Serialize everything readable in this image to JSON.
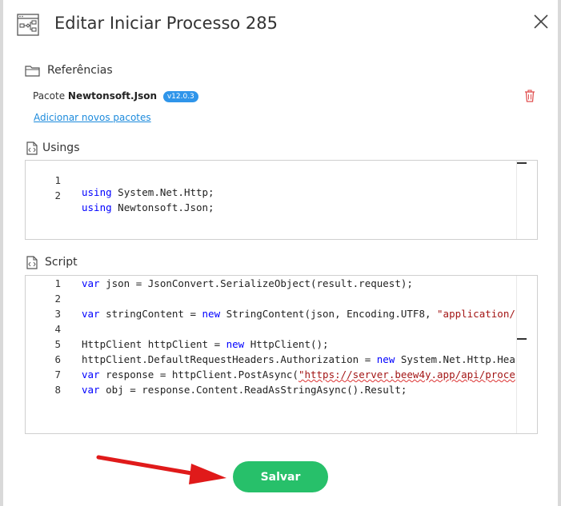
{
  "dialog": {
    "title": "Editar Iniciar Processo 285",
    "save_label": "Salvar"
  },
  "references": {
    "label": "Referências",
    "package_prefix": "Pacote",
    "package_name": "Newtonsoft.Json",
    "package_version": "v12.0.3",
    "add_link": "Adicionar novos pacotes"
  },
  "usings": {
    "label": "Usings",
    "lines": [
      {
        "n": "1",
        "tokens": [
          {
            "t": "kw",
            "v": "using"
          },
          {
            "t": "",
            "v": " System.Net.Http;"
          }
        ]
      },
      {
        "n": "2",
        "tokens": [
          {
            "t": "kw",
            "v": "using"
          },
          {
            "t": "",
            "v": " Newtonsoft.Json;"
          }
        ]
      }
    ]
  },
  "script": {
    "label": "Script",
    "lines": [
      {
        "n": "1",
        "tokens": [
          {
            "t": "kw",
            "v": "var"
          },
          {
            "t": "",
            "v": " json = JsonConvert.SerializeObject(result.request);"
          }
        ]
      },
      {
        "n": "2",
        "tokens": []
      },
      {
        "n": "3",
        "tokens": [
          {
            "t": "kw",
            "v": "var"
          },
          {
            "t": "",
            "v": " stringContent = "
          },
          {
            "t": "kw",
            "v": "new"
          },
          {
            "t": "",
            "v": " StringContent(json, Encoding.UTF8, "
          },
          {
            "t": "str",
            "v": "\"application/"
          }
        ]
      },
      {
        "n": "4",
        "tokens": []
      },
      {
        "n": "5",
        "tokens": [
          {
            "t": "",
            "v": "HttpClient httpClient = "
          },
          {
            "t": "kw",
            "v": "new"
          },
          {
            "t": "",
            "v": " HttpClient();"
          }
        ]
      },
      {
        "n": "6",
        "tokens": [
          {
            "t": "",
            "v": "httpClient.DefaultRequestHeaders.Authorization = "
          },
          {
            "t": "kw",
            "v": "new"
          },
          {
            "t": "",
            "v": " System.Net.Http.Hea"
          }
        ]
      },
      {
        "n": "7",
        "tokens": [
          {
            "t": "kw",
            "v": "var"
          },
          {
            "t": "",
            "v": " response = httpClient.PostAsync("
          },
          {
            "t": "str squig",
            "v": "\"https://server.beew4y.app/api/proce"
          }
        ]
      },
      {
        "n": "8",
        "tokens": [
          {
            "t": "kw",
            "v": "var"
          },
          {
            "t": "",
            "v": " obj = response.Content.ReadAsStringAsync().Result;"
          }
        ]
      }
    ]
  },
  "icons": {
    "header": "flowchart-icon",
    "references": "folder-icon",
    "usings": "code-file-icon",
    "script": "code-file-icon",
    "close": "close-icon",
    "delete": "trash-icon",
    "annotation": "red-arrow"
  },
  "colors": {
    "accent": "#27c06a",
    "link": "#1d8bdc",
    "badge": "#2f95ea",
    "danger": "#e05050",
    "keyword": "#0000ff",
    "string": "#a31515"
  }
}
